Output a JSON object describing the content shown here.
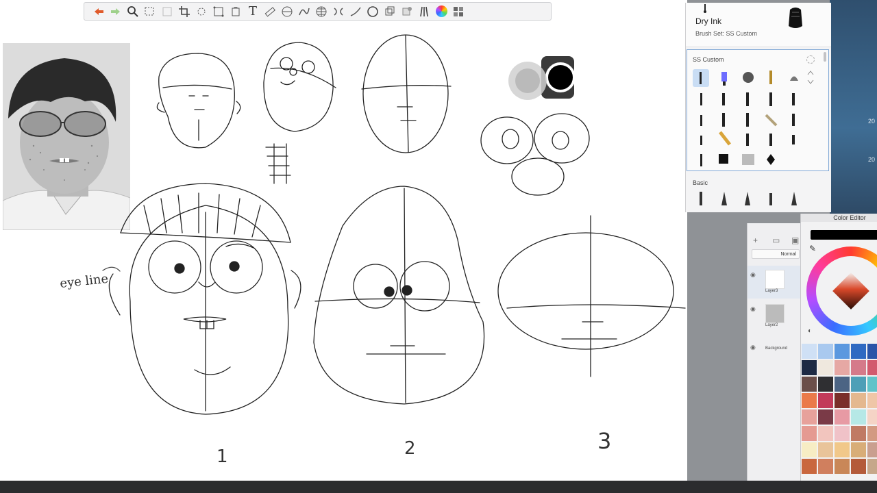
{
  "toolbar": {
    "tools": [
      "undo-icon",
      "redo-icon",
      "magnify-icon",
      "select-icon",
      "transform-icon",
      "crop-icon",
      "symmetry-icon",
      "perspective-icon",
      "fill-icon",
      "text-icon",
      "ruler-icon",
      "ellipse-guide-icon",
      "curve-icon",
      "grid-icon",
      "flip-icon",
      "stroke-icon",
      "circle-icon",
      "layers-icon",
      "copic-icon",
      "brush-library-icon",
      "color-wheel-icon",
      "palette-grid-icon"
    ],
    "text_tool_glyph": "T"
  },
  "canvas": {
    "labels": {
      "note": "eye line",
      "num1": "1",
      "num2": "2",
      "num3": "3"
    }
  },
  "brush_panel": {
    "brush_name": "Dry Ink",
    "brush_set": "Brush Set: SS Custom",
    "set_title": "SS Custom",
    "basic_title": "Basic"
  },
  "layers_panel": {
    "blend_mode": "Normal",
    "layers": [
      {
        "name": "Layer3"
      },
      {
        "name": "Layer2"
      },
      {
        "name": "Background"
      }
    ]
  },
  "color_editor": {
    "title": "Color Editor",
    "current_color": "#000000",
    "palette": [
      [
        "#cfe0f5",
        "#a9c9ef",
        "#5b98df",
        "#2f6ac2",
        "#2a55a8"
      ],
      [
        "#1d2a44",
        "#efe8de",
        "#e6a8a4",
        "#d57a8a",
        "#d25a6e"
      ],
      [
        "#6b4f4a",
        "#2f2f32",
        "#4c6484",
        "#4e9fb7",
        "#60c3c9"
      ],
      [
        "#ea7a4a",
        "#c23a5a",
        "#7a2e2a",
        "#e4b88f",
        "#efc6a7"
      ],
      [
        "#e7a19b",
        "#7a3a47",
        "#e79aa4",
        "#b6e8e6",
        "#f5d4c6"
      ],
      [
        "#e59a92",
        "#f2c5be",
        "#f0c2c8",
        "#c07a64",
        "#d39a82"
      ],
      [
        "#f7edc4",
        "#e9c49a",
        "#f1c88a",
        "#d8ad78",
        "#c99f8f"
      ],
      [
        "#c9673e",
        "#d07f5e",
        "#c98758",
        "#b45b3a",
        "#c6a78a"
      ]
    ]
  },
  "right_edge": {
    "dates": [
      "20",
      "20"
    ]
  }
}
